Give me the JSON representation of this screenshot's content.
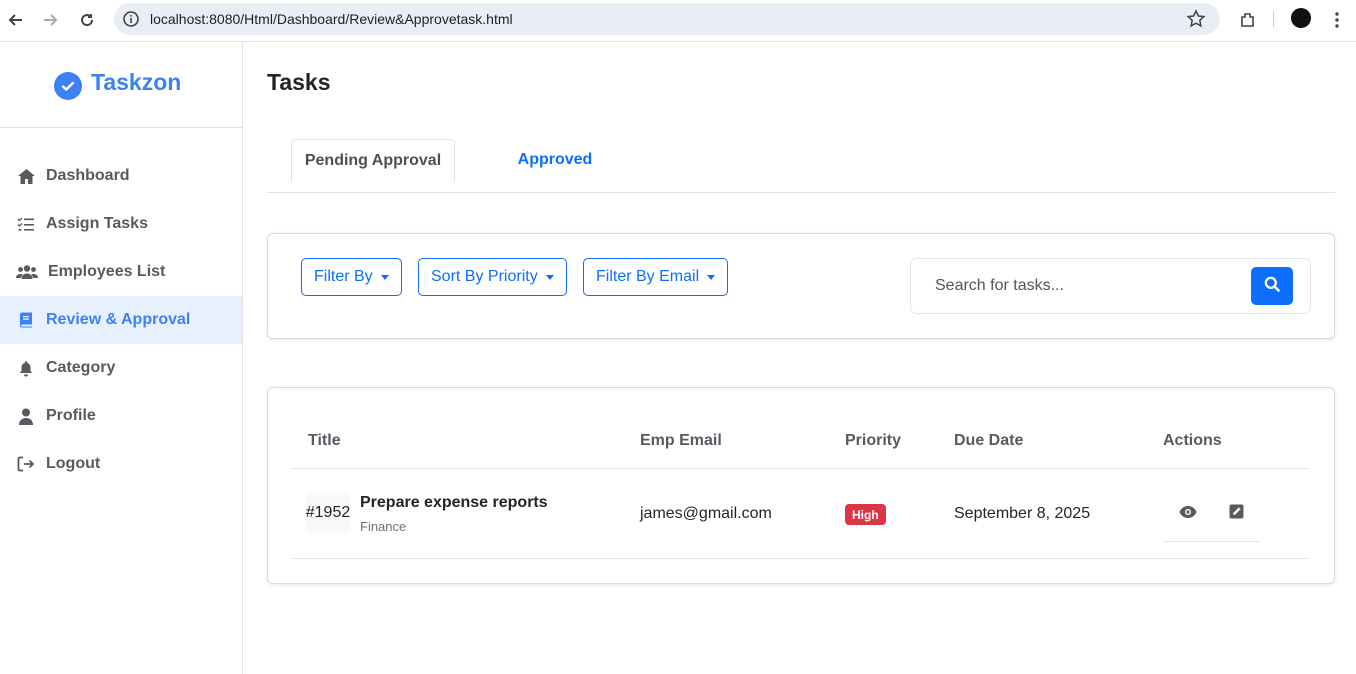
{
  "browser": {
    "url": "localhost:8080/Html/Dashboard/Review&Approvetask.html"
  },
  "brand": {
    "name": "Taskzon",
    "color": "#3d82f4"
  },
  "sidebar": {
    "items": [
      {
        "label": "Dashboard",
        "icon": "home-icon"
      },
      {
        "label": "Assign Tasks",
        "icon": "list-check-icon"
      },
      {
        "label": "Employees List",
        "icon": "users-icon"
      },
      {
        "label": "Review & Approval",
        "icon": "book-icon",
        "active": true
      },
      {
        "label": "Category",
        "icon": "bell-icon"
      },
      {
        "label": "Profile",
        "icon": "user-icon"
      },
      {
        "label": "Logout",
        "icon": "logout-icon"
      }
    ]
  },
  "page": {
    "title": "Tasks"
  },
  "tabs": [
    {
      "label": "Pending Approval",
      "active": true
    },
    {
      "label": "Approved",
      "active": false
    }
  ],
  "filters": {
    "filter_by": "Filter By",
    "sort_by_priority": "Sort By Priority",
    "filter_by_email": "Filter By Email",
    "search_placeholder": "Search for tasks..."
  },
  "table": {
    "headers": [
      "Title",
      "Emp Email",
      "Priority",
      "Due Date",
      "Actions"
    ],
    "rows": [
      {
        "id": "#1952",
        "title": "Prepare expense reports",
        "category": "Finance",
        "email": "james@gmail.com",
        "priority": "High",
        "due_date": "September 8, 2025"
      }
    ]
  },
  "colors": {
    "primary": "#0d6efd",
    "danger": "#dc3545",
    "accent": "#3d82f4"
  }
}
